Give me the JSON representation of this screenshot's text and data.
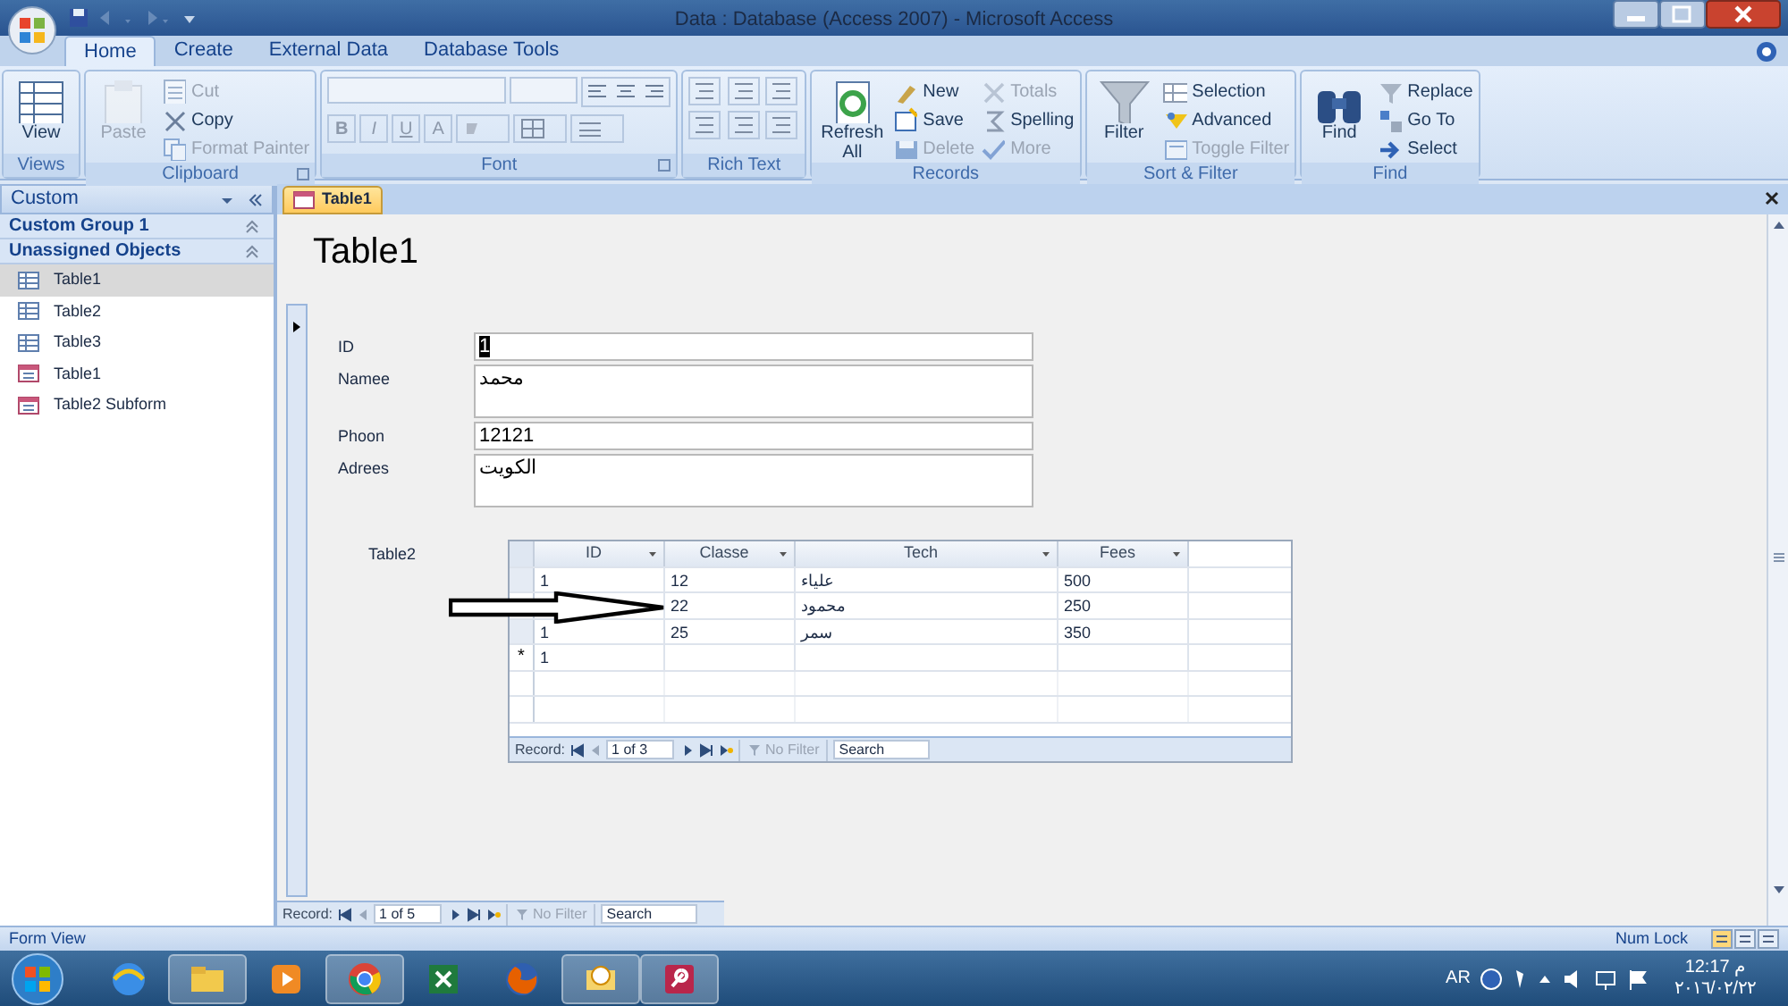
{
  "window": {
    "title": "Data : Database (Access 2007) - Microsoft Access"
  },
  "ribbon": {
    "tabs": [
      {
        "label": "Home",
        "selected": true
      },
      {
        "label": "Create",
        "selected": false
      },
      {
        "label": "External Data",
        "selected": false
      },
      {
        "label": "Database Tools",
        "selected": false
      }
    ],
    "groups": [
      {
        "label": "Views",
        "kind": "buttons",
        "items": [
          {
            "label": "View",
            "kind": "large",
            "disabled": false
          }
        ]
      },
      {
        "label": "Clipboard",
        "kind": "buttons",
        "items": [
          {
            "label": "Paste",
            "kind": "large",
            "disabled": true
          },
          {
            "label": "Cut",
            "kind": "small",
            "disabled": true
          },
          {
            "label": "Copy",
            "kind": "small",
            "disabled": false
          },
          {
            "label": "Format Painter",
            "kind": "small",
            "disabled": true
          }
        ]
      },
      {
        "label": "Font",
        "kind": "font",
        "items": [
          {
            "label": "B",
            "disabled": true
          },
          {
            "label": "I",
            "disabled": true
          },
          {
            "label": "U",
            "disabled": true
          },
          {
            "label": "A",
            "disabled": true
          }
        ]
      },
      {
        "label": "Rich Text",
        "kind": "richtext"
      },
      {
        "label": "Records",
        "kind": "buttons",
        "items": [
          {
            "label": "Refresh All",
            "kind": "large",
            "disabled": false
          },
          {
            "label": "New",
            "kind": "small",
            "disabled": false
          },
          {
            "label": "Save",
            "kind": "small",
            "disabled": false
          },
          {
            "label": "Delete",
            "kind": "small",
            "disabled": true
          },
          {
            "label": "Totals",
            "kind": "small",
            "disabled": true
          },
          {
            "label": "Spelling",
            "kind": "small",
            "disabled": false
          },
          {
            "label": "More",
            "kind": "small",
            "disabled": true
          }
        ]
      },
      {
        "label": "Sort & Filter",
        "kind": "buttons",
        "items": [
          {
            "label": "Filter",
            "kind": "large",
            "disabled": false
          },
          {
            "label": "Selection",
            "kind": "small",
            "disabled": false
          },
          {
            "label": "Advanced",
            "kind": "small",
            "disabled": false
          },
          {
            "label": "Toggle Filter",
            "kind": "small",
            "disabled": true
          }
        ]
      },
      {
        "label": "Find",
        "kind": "buttons",
        "items": [
          {
            "label": "Find",
            "kind": "large",
            "disabled": false
          },
          {
            "label": "Replace",
            "kind": "small",
            "disabled": false
          },
          {
            "label": "Go To",
            "kind": "small",
            "disabled": false
          },
          {
            "label": "Select",
            "kind": "small",
            "disabled": false
          }
        ]
      }
    ]
  },
  "nav_pane": {
    "header": "Custom",
    "groups": [
      {
        "label": "Custom Group 1"
      },
      {
        "label": "Unassigned Objects",
        "items": [
          {
            "label": "Table1",
            "kind": "table",
            "selected": true
          },
          {
            "label": "Table2",
            "kind": "table",
            "selected": false
          },
          {
            "label": "Table3",
            "kind": "table",
            "selected": false
          },
          {
            "label": "Table1",
            "kind": "form",
            "selected": false
          },
          {
            "label": "Table2 Subform",
            "kind": "form",
            "selected": false
          }
        ]
      }
    ]
  },
  "document_tab": {
    "label": "Table1"
  },
  "form": {
    "title": "Table1",
    "fields": [
      {
        "label": "ID",
        "value": "1",
        "kind": "single",
        "selected": true
      },
      {
        "label": "Namee",
        "value": "محمد",
        "kind": "multi",
        "selected": false
      },
      {
        "label": "Phoon",
        "value": "12121",
        "kind": "single",
        "selected": false
      },
      {
        "label": "Adrees",
        "value": "الكويت",
        "kind": "multi",
        "selected": false
      }
    ],
    "subform": {
      "label": "Table2",
      "columns": [
        "ID",
        "Classe",
        "Tech",
        "Fees"
      ],
      "rows": [
        {
          "cells": [
            "1",
            "12",
            "علياء",
            "500"
          ]
        },
        {
          "cells": [
            null,
            "22",
            "محمود",
            "250"
          ]
        },
        {
          "cells": [
            "1",
            "25",
            "سمر",
            "350"
          ]
        }
      ],
      "new_row": {
        "marker": "*",
        "cells": [
          "1"
        ]
      },
      "record_nav": {
        "label": "Record:",
        "position": "1 of 3",
        "filter": "No Filter",
        "search": "Search"
      }
    },
    "record_nav": {
      "label": "Record:",
      "position": "1 of 5",
      "filter": "No Filter",
      "search": "Search"
    }
  },
  "status_bar": {
    "left": "Form View",
    "right": "Num Lock"
  },
  "taskbar": {
    "apps": [
      {
        "running": false
      },
      {
        "running": true
      },
      {
        "running": false
      },
      {
        "running": true
      },
      {
        "running": false
      },
      {
        "running": false
      },
      {
        "running": true
      },
      {
        "running": true
      }
    ],
    "language": "AR",
    "time": "12:17 م",
    "date": "٢٠١٦/٠٢/٢٢"
  }
}
